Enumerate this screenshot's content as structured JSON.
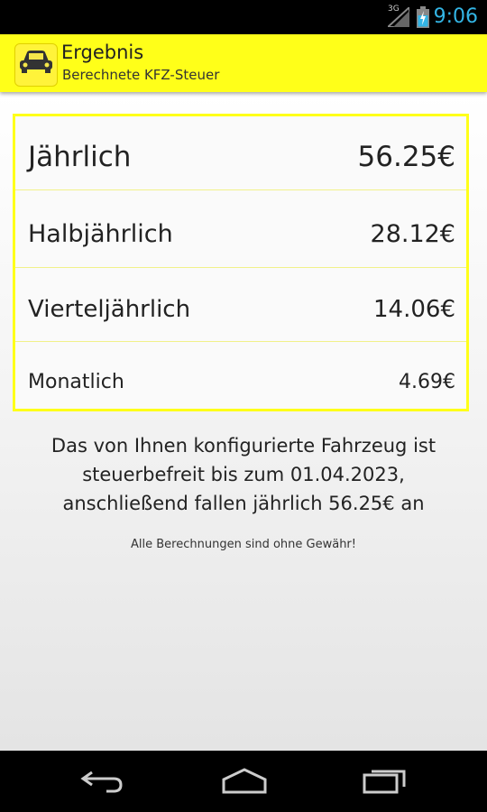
{
  "status_bar": {
    "network_label": "3G",
    "time": "9:06",
    "icons": [
      "signal-icon",
      "battery-charging-icon"
    ],
    "accent_color": "#33b5e5"
  },
  "action_bar": {
    "title": "Ergebnis",
    "subtitle": "Berechnete KFZ-Steuer",
    "icon": "car-icon",
    "background_color": "#ffff19"
  },
  "results": [
    {
      "label": "Jährlich",
      "value": "56.25€"
    },
    {
      "label": "Halbjährlich",
      "value": "28.12€"
    },
    {
      "label": "Vierteljährlich",
      "value": "14.06€"
    },
    {
      "label": "Monatlich",
      "value": "4.69€"
    }
  ],
  "info": {
    "line1": "Das von Ihnen konfigurierte Fahrzeug ist",
    "line2": "steuerbefreit bis zum 01.04.2023,",
    "line3": "anschließend fallen jährlich 56.25€ an"
  },
  "disclaimer": "Alle Berechnungen sind ohne Gewähr!",
  "nav_bar": {
    "buttons": [
      "back-icon",
      "home-icon",
      "recent-apps-icon"
    ]
  }
}
